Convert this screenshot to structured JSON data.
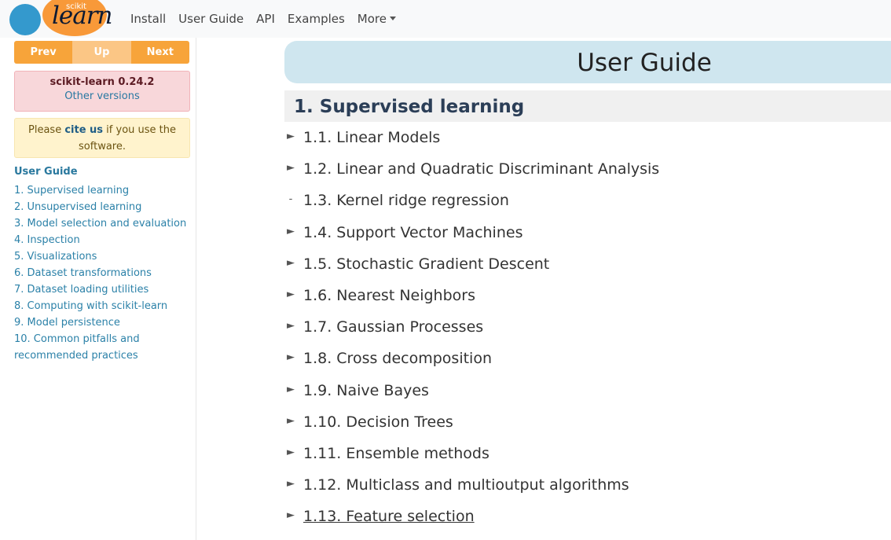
{
  "logo": {
    "small": "scikit",
    "big": "learn"
  },
  "nav": {
    "items": [
      "Install",
      "User Guide",
      "API",
      "Examples"
    ],
    "more": "More"
  },
  "sidebar": {
    "prev": "Prev",
    "up": "Up",
    "next": "Next",
    "version_title": "scikit-learn 0.24.2",
    "version_link": "Other versions",
    "cite_pre": "Please ",
    "cite_link": "cite us",
    "cite_post": " if you use the software.",
    "toc_title": "User Guide",
    "toc": [
      "1. Supervised learning",
      "2. Unsupervised learning",
      "3. Model selection and evaluation",
      "4. Inspection",
      "5. Visualizations",
      "6. Dataset transformations",
      "7. Dataset loading utilities",
      "8. Computing with scikit-learn",
      "9. Model persistence",
      "10. Common pitfalls and",
      "recommended practices"
    ]
  },
  "main": {
    "title": "User Guide",
    "section": "1. Supervised learning",
    "items": [
      {
        "bullet": "►",
        "label": "1.1. Linear Models"
      },
      {
        "bullet": "►",
        "label": "1.2. Linear and Quadratic Discriminant Analysis"
      },
      {
        "bullet": "-",
        "label": "1.3. Kernel ridge regression"
      },
      {
        "bullet": "►",
        "label": "1.4. Support Vector Machines"
      },
      {
        "bullet": "►",
        "label": "1.5. Stochastic Gradient Descent"
      },
      {
        "bullet": "►",
        "label": "1.6. Nearest Neighbors"
      },
      {
        "bullet": "►",
        "label": "1.7. Gaussian Processes"
      },
      {
        "bullet": "►",
        "label": "1.8. Cross decomposition"
      },
      {
        "bullet": "►",
        "label": "1.9. Naive Bayes"
      },
      {
        "bullet": "►",
        "label": "1.10. Decision Trees"
      },
      {
        "bullet": "►",
        "label": "1.11. Ensemble methods"
      },
      {
        "bullet": "►",
        "label": "1.12. Multiclass and multioutput algorithms"
      },
      {
        "bullet": "►",
        "label": "1.13. Feature selection"
      }
    ]
  }
}
